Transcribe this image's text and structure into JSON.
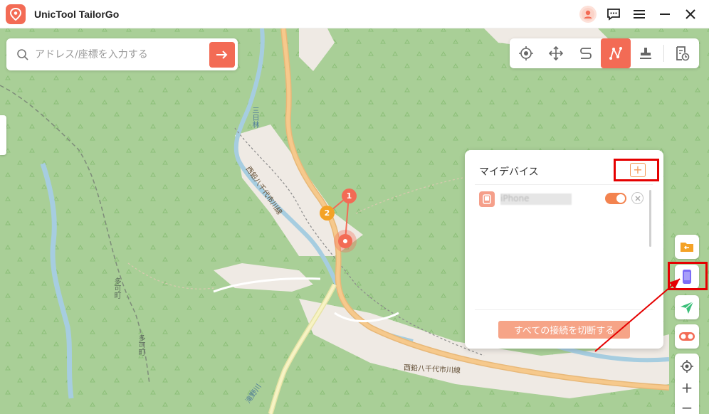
{
  "app": {
    "title": "UnicTool TailorGo",
    "logo_icon": "map-pin-logo-icon",
    "brand_color": "#f36b55"
  },
  "titlebar_actions": [
    {
      "name": "account-avatar",
      "icon": "user-avatar-icon"
    },
    {
      "name": "feedback-button",
      "icon": "chat-icon"
    },
    {
      "name": "menu-button",
      "icon": "hamburger-icon"
    },
    {
      "name": "minimize-button",
      "icon": "minimize-icon"
    },
    {
      "name": "close-button",
      "icon": "close-icon"
    }
  ],
  "search": {
    "placeholder": "アドレス/座標を入力する",
    "value": "",
    "go_icon": "arrow-right-icon"
  },
  "modes": [
    {
      "name": "teleport-mode",
      "icon": "crosshair-icon",
      "active": false
    },
    {
      "name": "joystick-mode",
      "icon": "move-arrows-icon",
      "active": false
    },
    {
      "name": "two-spot-mode",
      "icon": "s-route-icon",
      "active": false
    },
    {
      "name": "multi-spot-mode",
      "icon": "multi-route-icon",
      "active": true
    },
    {
      "name": "jump-teleport-mode",
      "icon": "stamp-icon",
      "active": false
    },
    {
      "name": "history-mode",
      "icon": "history-doc-icon",
      "active": false
    }
  ],
  "map": {
    "road_labels": [
      "西鉛八千代市川線",
      "西鉛八千代市川線",
      "三日林",
      "多可町",
      "多可町",
      "滝野川"
    ],
    "route_markers": [
      "1",
      "2"
    ]
  },
  "device_panel": {
    "title": "マイデバイス",
    "add_icon": "+",
    "devices": [
      {
        "name": "iPhone",
        "connected": true
      }
    ],
    "disconnect_label": "すべての接続を切断する"
  },
  "side_tools": [
    {
      "name": "import-gpx-button",
      "icon": "folder-import-icon"
    },
    {
      "name": "device-manager-button",
      "icon": "phone-icon"
    },
    {
      "name": "navigate-button",
      "icon": "paper-plane-icon"
    },
    {
      "name": "toggle-switch-button",
      "icon": "switch-icon"
    }
  ],
  "zoom": {
    "locate_icon": "locate-icon",
    "plus": "+",
    "minus": "−"
  }
}
